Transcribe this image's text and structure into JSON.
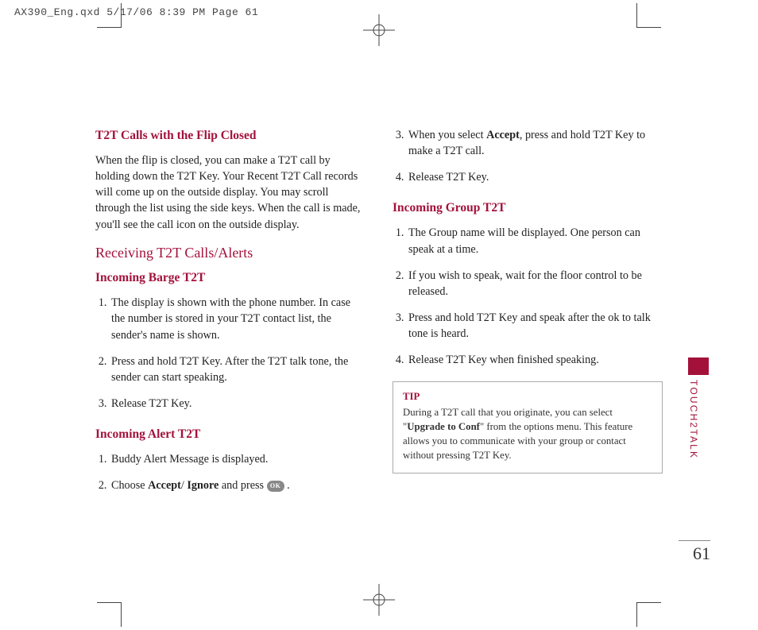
{
  "print_header": "AX390_Eng.qxd  5/17/06  8:39 PM  Page 61",
  "left": {
    "h1": "T2T Calls with the Flip Closed",
    "p1": "When the flip is closed, you can make a T2T call by holding down the T2T Key. Your Recent T2T Call records will come up on the outside display. You may scroll through the list using the side keys. When the call is made, you'll see the call icon on the outside display.",
    "h2": "Receiving T2T Calls/Alerts",
    "h3a": "Incoming Barge T2T",
    "barge": [
      "The display is shown with the phone number. In case the number is stored in your T2T contact list, the sender's name is shown.",
      "Press and hold T2T Key. After the T2T talk tone, the sender can start speaking.",
      "Release T2T Key."
    ],
    "h3b": "Incoming Alert T2T",
    "alert1": "Buddy Alert Message is displayed.",
    "alert2_a": "Choose ",
    "alert2_b": "Accept",
    "alert2_c": "/ ",
    "alert2_d": "Ignore",
    "alert2_e": " and press ",
    "alert2_ok": "OK",
    "alert2_f": " ."
  },
  "right": {
    "step3_a": "When you select ",
    "step3_b": "Accept",
    "step3_c": ", press and hold T2T Key to make a T2T call.",
    "step4": "Release T2T Key.",
    "h3": "Incoming Group T2T",
    "group": [
      "The Group name will be displayed. One person can speak at a time.",
      "If you wish to speak, wait for the floor control to be released.",
      "Press and hold T2T Key and speak after the ok to talk tone is heard.",
      "Release T2T Key when finished speaking."
    ],
    "tip_title": "TIP",
    "tip_a": "During a T2T call that you originate, you can select \"",
    "tip_b": "Upgrade to Conf",
    "tip_c": "\" from the options menu. This feature allows you to communicate with your group or contact without pressing  T2T Key."
  },
  "side_label": "TOUCH2TALK",
  "page_number": "61"
}
